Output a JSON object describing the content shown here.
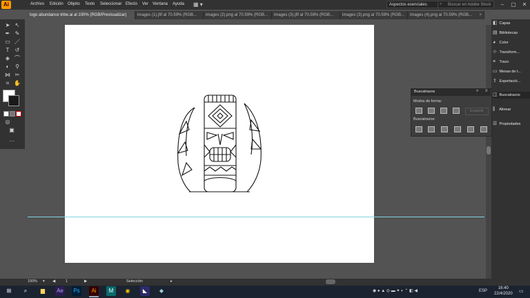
{
  "app": {
    "logo": "Ai",
    "accent": "#ff9a00"
  },
  "menu": [
    "Archivo",
    "Edición",
    "Objeto",
    "Texto",
    "Seleccionar",
    "Efecto",
    "Ver",
    "Ventana",
    "Ayuda"
  ],
  "workspace": {
    "label": "Aspectos esenciales",
    "search_placeholder": "Buscar en Adobe Stock"
  },
  "tabs": [
    {
      "label": "logo abundance tribe.ai al 100% (RGB/Previsualizar)",
      "active": true
    },
    {
      "label": "images (1).jfif al 70.59% (RGB..."
    },
    {
      "label": "images (2).png al 70.59% (RGB..."
    },
    {
      "label": "images (3).jfif al 70.59% (RGB..."
    },
    {
      "label": "images (3).png al 70.59% (RGB..."
    },
    {
      "label": "images (4).png al 70.59% (RGB..."
    }
  ],
  "right_panels": [
    {
      "label": "Capas",
      "icon": "layers-icon"
    },
    {
      "label": "Bibliotecas",
      "icon": "libraries-icon"
    },
    {
      "label": "Color",
      "icon": "color-icon"
    },
    {
      "label": "Transform...",
      "icon": "transform-icon"
    },
    {
      "label": "Trazo",
      "icon": "stroke-icon"
    },
    {
      "label": "Mesas de t...",
      "icon": "artboards-icon"
    },
    {
      "label": "Exportació...",
      "icon": "export-icon"
    },
    {
      "label": "Buscatrazos",
      "icon": "pathfinder-icon",
      "active": true
    },
    {
      "label": "Alinear",
      "icon": "align-icon"
    },
    {
      "label": "Propiedades",
      "icon": "properties-icon"
    }
  ],
  "pathfinder": {
    "title": "Buscatrazos",
    "shape_modes_label": "Modos de forma:",
    "pathfinders_label": "Buscatrazos:",
    "expand_label": "Expandir"
  },
  "status": {
    "zoom": "100%",
    "artboard": "1",
    "tool": "Selección"
  },
  "taskbar": {
    "lang": "ESP",
    "time": "16:40",
    "date": "22/4/2020"
  }
}
